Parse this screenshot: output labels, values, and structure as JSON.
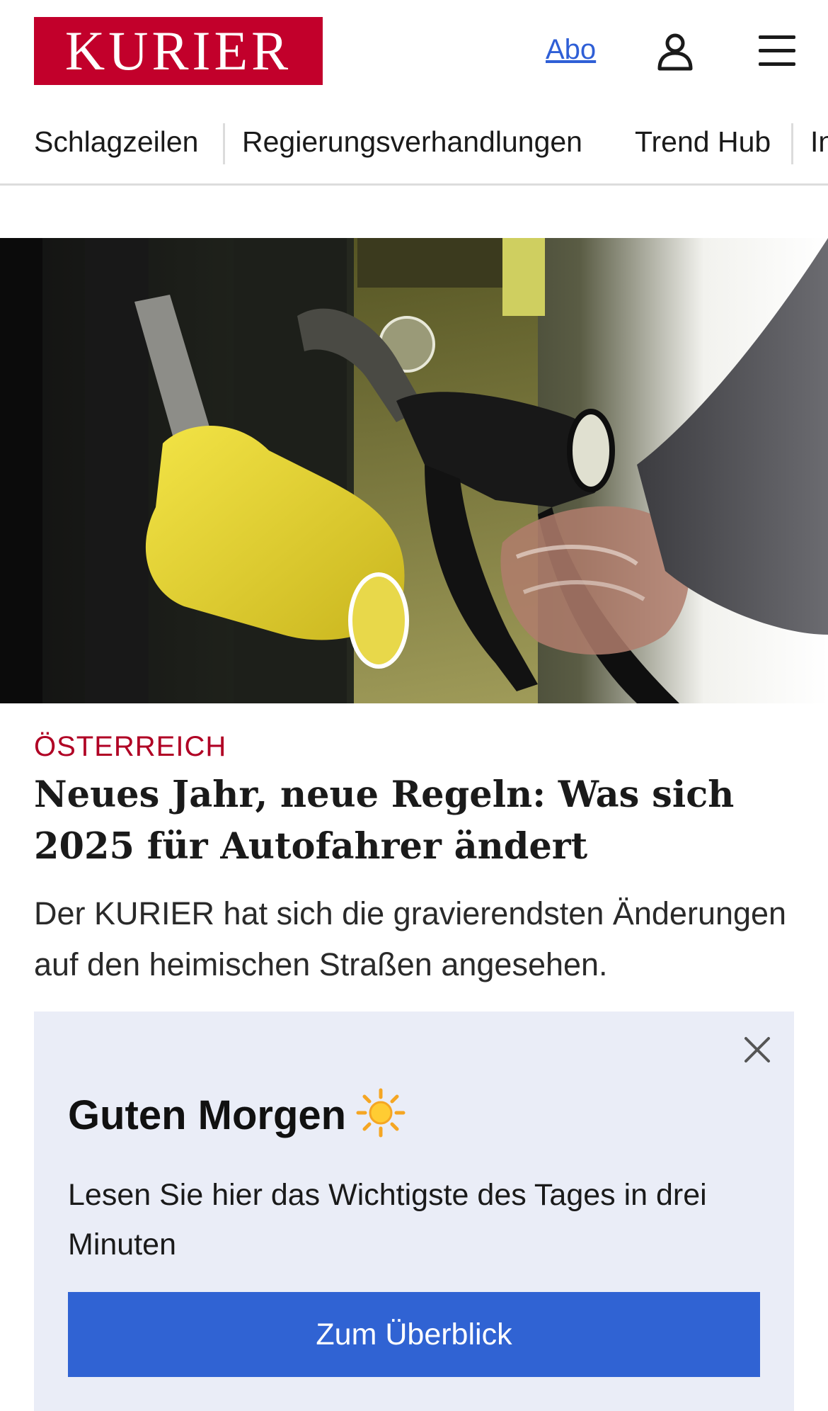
{
  "header": {
    "logo_text": "KURIER",
    "abo_label": "Abo",
    "user_icon": "user-icon",
    "menu_icon": "hamburger-menu-icon",
    "brand_color": "#c2002b"
  },
  "nav": {
    "items": [
      {
        "label": "Schlagzeilen"
      },
      {
        "label": "Regierungsverhandlungen"
      },
      {
        "label": "Trend Hub"
      },
      {
        "label": "In"
      }
    ]
  },
  "article": {
    "image_alt": "fuel-pump-nozzles-photo",
    "kicker": "ÖSTERREICH",
    "headline": "Neues Jahr, neue Regeln: Was sich 2025 für Autofahrer ändert",
    "teaser": "Der KURIER hat sich die gravierendsten Änderungen auf den heimischen Straßen angesehen."
  },
  "popup": {
    "title": "Guten Morgen",
    "title_icon": "sun-icon",
    "text": "Lesen Sie hier das Wichtigste des Tages in drei Minuten",
    "button_label": "Zum Überblick",
    "close_icon": "close-icon",
    "button_color": "#3063d3",
    "background_color": "#eaedf7"
  }
}
